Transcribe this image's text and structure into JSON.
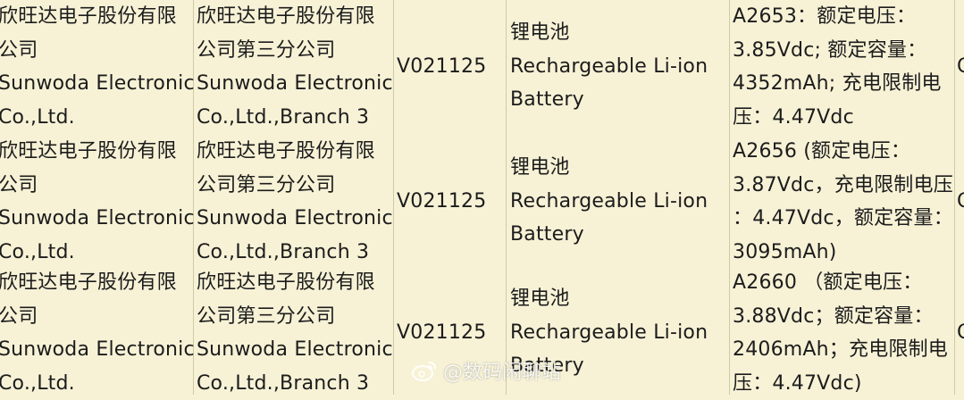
{
  "rows": [
    {
      "manufacturer": [
        "欣旺达电子股份有限",
        "公司",
        "Sunwoda Electronic",
        "Co.,Ltd."
      ],
      "branch": [
        "欣旺达电子股份有限",
        "公司第三分公司",
        "Sunwoda Electronic",
        "Co.,Ltd.,Branch 3"
      ],
      "model": "V021125",
      "description": [
        "锂电池",
        "Rechargeable Li-ion",
        "Battery"
      ],
      "spec": [
        "A2653：额定电压：",
        "3.85Vdc; 额定容量：",
        "4352mAh; 充电限制电",
        "压：4.47Vdc"
      ],
      "edge": "C"
    },
    {
      "manufacturer": [
        "欣旺达电子股份有限",
        "公司",
        "Sunwoda Electronic",
        "Co.,Ltd."
      ],
      "branch": [
        "欣旺达电子股份有限",
        "公司第三分公司",
        "Sunwoda Electronic",
        "Co.,Ltd.,Branch 3"
      ],
      "model": "V021125",
      "description": [
        "锂电池",
        "Rechargeable Li-ion",
        "Battery"
      ],
      "spec": [
        "A2656 (额定电压：",
        "3.87Vdc，充电限制电压",
        "：4.47Vdc，额定容量：",
        "3095mAh)"
      ],
      "edge": "C"
    },
    {
      "manufacturer": [
        "欣旺达电子股份有限",
        "公司",
        "Sunwoda Electronic",
        "Co.,Ltd."
      ],
      "branch": [
        "欣旺达电子股份有限",
        "公司第三分公司",
        "Sunwoda Electronic",
        "Co.,Ltd.,Branch 3"
      ],
      "model": "V021125",
      "description": [
        "锂电池",
        "Rechargeable Li-ion",
        "Battery"
      ],
      "spec": [
        "A2660 （额定电压：",
        "3.88Vdc；额定容量：",
        "2406mAh；充电限制电",
        "压：4.47Vdc)"
      ],
      "edge": "C"
    }
  ],
  "watermark": {
    "icon": "weibo-icon",
    "text": "@数码闲聊站"
  },
  "colors": {
    "background": "#f7f2d6",
    "grid": "#cfc9a8",
    "text": "#1c1c1c"
  }
}
